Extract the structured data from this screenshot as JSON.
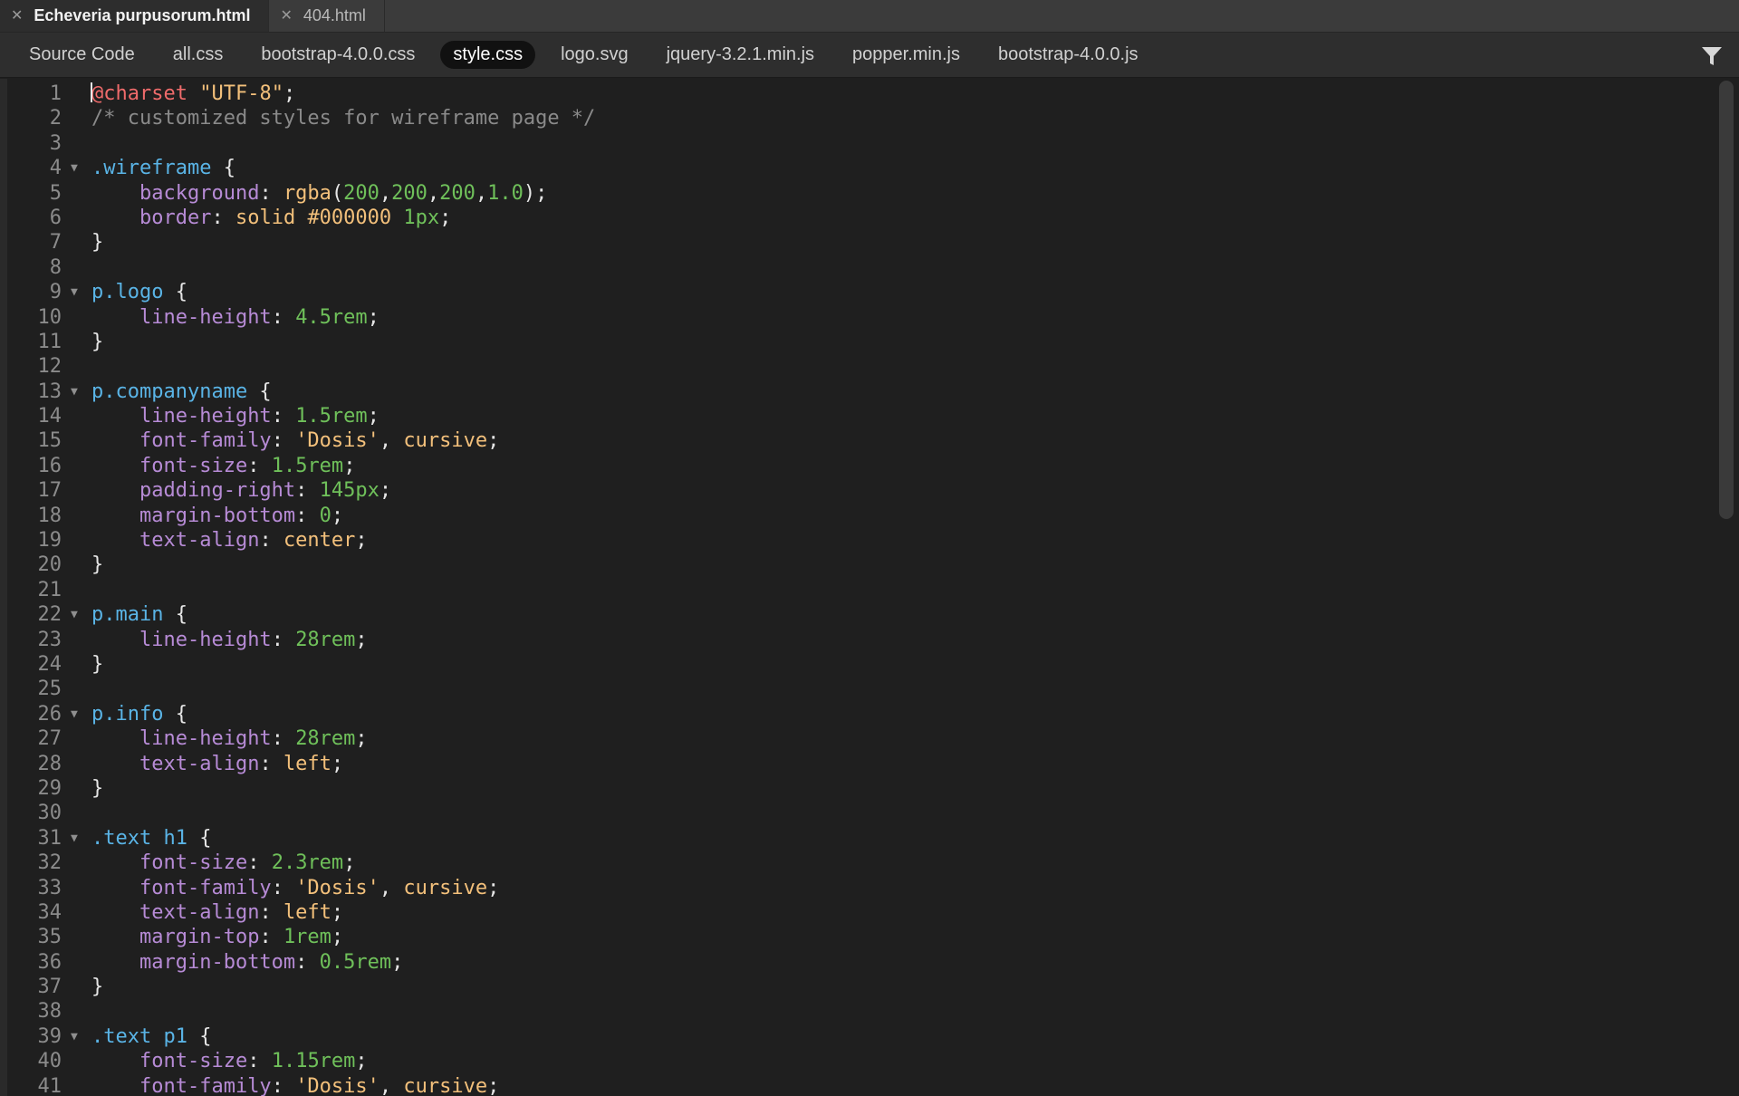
{
  "file_tabs": [
    {
      "label": "Echeveria purpusorum.html",
      "active": true
    },
    {
      "label": "404.html",
      "active": false
    }
  ],
  "related_files": [
    {
      "label": "Source Code",
      "active": false
    },
    {
      "label": "all.css",
      "active": false
    },
    {
      "label": "bootstrap-4.0.0.css",
      "active": false
    },
    {
      "label": "style.css",
      "active": true
    },
    {
      "label": "logo.svg",
      "active": false
    },
    {
      "label": "jquery-3.2.1.min.js",
      "active": false
    },
    {
      "label": "popper.min.js",
      "active": false
    },
    {
      "label": "bootstrap-4.0.0.js",
      "active": false
    }
  ],
  "icons": {
    "close_glyph": "✕",
    "fold_glyph": "▼",
    "filter": "filter-icon"
  },
  "colors": {
    "keyword_at": "#ef6b6b",
    "string": "#f3c07b",
    "comment": "#8a8a8a",
    "selector": "#5ab4e6",
    "property": "#b78bd6",
    "number": "#6fc05a",
    "value": "#f3c07b"
  },
  "editor": {
    "lines": [
      {
        "n": "1",
        "fold": false,
        "tokens": [
          [
            "at",
            "@charset"
          ],
          [
            "pun",
            " "
          ],
          [
            "str",
            "\"UTF-8\""
          ],
          [
            "pun",
            ";"
          ]
        ]
      },
      {
        "n": "2",
        "fold": false,
        "tokens": [
          [
            "com",
            "/* customized styles for wireframe page */"
          ]
        ]
      },
      {
        "n": "3",
        "fold": false,
        "tokens": []
      },
      {
        "n": "4",
        "fold": true,
        "tokens": [
          [
            "sel",
            ".wireframe"
          ],
          [
            "pun",
            " {"
          ]
        ]
      },
      {
        "n": "5",
        "fold": false,
        "tokens": [
          [
            "pun",
            "    "
          ],
          [
            "prop",
            "background"
          ],
          [
            "pun",
            ": "
          ],
          [
            "val",
            "rgba"
          ],
          [
            "pun",
            "("
          ],
          [
            "num",
            "200"
          ],
          [
            "pun",
            ","
          ],
          [
            "num",
            "200"
          ],
          [
            "pun",
            ","
          ],
          [
            "num",
            "200"
          ],
          [
            "pun",
            ","
          ],
          [
            "num",
            "1.0"
          ],
          [
            "pun",
            ");"
          ]
        ]
      },
      {
        "n": "6",
        "fold": false,
        "tokens": [
          [
            "pun",
            "    "
          ],
          [
            "prop",
            "border"
          ],
          [
            "pun",
            ": "
          ],
          [
            "val",
            "solid #000000 "
          ],
          [
            "num",
            "1px"
          ],
          [
            "pun",
            ";"
          ]
        ]
      },
      {
        "n": "7",
        "fold": false,
        "tokens": [
          [
            "pun",
            "}"
          ]
        ]
      },
      {
        "n": "8",
        "fold": false,
        "tokens": []
      },
      {
        "n": "9",
        "fold": true,
        "tokens": [
          [
            "sel",
            "p.logo"
          ],
          [
            "pun",
            " {"
          ]
        ]
      },
      {
        "n": "10",
        "fold": false,
        "tokens": [
          [
            "pun",
            "    "
          ],
          [
            "prop",
            "line-height"
          ],
          [
            "pun",
            ": "
          ],
          [
            "num",
            "4.5rem"
          ],
          [
            "pun",
            ";"
          ]
        ]
      },
      {
        "n": "11",
        "fold": false,
        "tokens": [
          [
            "pun",
            "}"
          ]
        ]
      },
      {
        "n": "12",
        "fold": false,
        "tokens": []
      },
      {
        "n": "13",
        "fold": true,
        "tokens": [
          [
            "sel",
            "p.companyname"
          ],
          [
            "pun",
            " {"
          ]
        ]
      },
      {
        "n": "14",
        "fold": false,
        "tokens": [
          [
            "pun",
            "    "
          ],
          [
            "prop",
            "line-height"
          ],
          [
            "pun",
            ": "
          ],
          [
            "num",
            "1.5rem"
          ],
          [
            "pun",
            ";"
          ]
        ]
      },
      {
        "n": "15",
        "fold": false,
        "tokens": [
          [
            "pun",
            "    "
          ],
          [
            "prop",
            "font-family"
          ],
          [
            "pun",
            ": "
          ],
          [
            "str",
            "'Dosis'"
          ],
          [
            "pun",
            ", "
          ],
          [
            "val",
            "cursive"
          ],
          [
            "pun",
            ";"
          ]
        ]
      },
      {
        "n": "16",
        "fold": false,
        "tokens": [
          [
            "pun",
            "    "
          ],
          [
            "prop",
            "font-size"
          ],
          [
            "pun",
            ": "
          ],
          [
            "num",
            "1.5rem"
          ],
          [
            "pun",
            ";"
          ]
        ]
      },
      {
        "n": "17",
        "fold": false,
        "tokens": [
          [
            "pun",
            "    "
          ],
          [
            "prop",
            "padding-right"
          ],
          [
            "pun",
            ": "
          ],
          [
            "num",
            "145px"
          ],
          [
            "pun",
            ";"
          ]
        ]
      },
      {
        "n": "18",
        "fold": false,
        "tokens": [
          [
            "pun",
            "    "
          ],
          [
            "prop",
            "margin-bottom"
          ],
          [
            "pun",
            ": "
          ],
          [
            "num",
            "0"
          ],
          [
            "pun",
            ";"
          ]
        ]
      },
      {
        "n": "19",
        "fold": false,
        "tokens": [
          [
            "pun",
            "    "
          ],
          [
            "prop",
            "text-align"
          ],
          [
            "pun",
            ": "
          ],
          [
            "val",
            "center"
          ],
          [
            "pun",
            ";"
          ]
        ]
      },
      {
        "n": "20",
        "fold": false,
        "tokens": [
          [
            "pun",
            "}"
          ]
        ]
      },
      {
        "n": "21",
        "fold": false,
        "tokens": []
      },
      {
        "n": "22",
        "fold": true,
        "tokens": [
          [
            "sel",
            "p.main"
          ],
          [
            "pun",
            " {"
          ]
        ]
      },
      {
        "n": "23",
        "fold": false,
        "tokens": [
          [
            "pun",
            "    "
          ],
          [
            "prop",
            "line-height"
          ],
          [
            "pun",
            ": "
          ],
          [
            "num",
            "28rem"
          ],
          [
            "pun",
            ";"
          ]
        ]
      },
      {
        "n": "24",
        "fold": false,
        "tokens": [
          [
            "pun",
            "}"
          ]
        ]
      },
      {
        "n": "25",
        "fold": false,
        "tokens": []
      },
      {
        "n": "26",
        "fold": true,
        "tokens": [
          [
            "sel",
            "p.info"
          ],
          [
            "pun",
            " {"
          ]
        ]
      },
      {
        "n": "27",
        "fold": false,
        "tokens": [
          [
            "pun",
            "    "
          ],
          [
            "prop",
            "line-height"
          ],
          [
            "pun",
            ": "
          ],
          [
            "num",
            "28rem"
          ],
          [
            "pun",
            ";"
          ]
        ]
      },
      {
        "n": "28",
        "fold": false,
        "tokens": [
          [
            "pun",
            "    "
          ],
          [
            "prop",
            "text-align"
          ],
          [
            "pun",
            ": "
          ],
          [
            "val",
            "left"
          ],
          [
            "pun",
            ";"
          ]
        ]
      },
      {
        "n": "29",
        "fold": false,
        "tokens": [
          [
            "pun",
            "}"
          ]
        ]
      },
      {
        "n": "30",
        "fold": false,
        "tokens": []
      },
      {
        "n": "31",
        "fold": true,
        "tokens": [
          [
            "sel",
            ".text h1"
          ],
          [
            "pun",
            " {"
          ]
        ]
      },
      {
        "n": "32",
        "fold": false,
        "tokens": [
          [
            "pun",
            "    "
          ],
          [
            "prop",
            "font-size"
          ],
          [
            "pun",
            ": "
          ],
          [
            "num",
            "2.3rem"
          ],
          [
            "pun",
            ";"
          ]
        ]
      },
      {
        "n": "33",
        "fold": false,
        "tokens": [
          [
            "pun",
            "    "
          ],
          [
            "prop",
            "font-family"
          ],
          [
            "pun",
            ": "
          ],
          [
            "str",
            "'Dosis'"
          ],
          [
            "pun",
            ", "
          ],
          [
            "val",
            "cursive"
          ],
          [
            "pun",
            ";"
          ]
        ]
      },
      {
        "n": "34",
        "fold": false,
        "tokens": [
          [
            "pun",
            "    "
          ],
          [
            "prop",
            "text-align"
          ],
          [
            "pun",
            ": "
          ],
          [
            "val",
            "left"
          ],
          [
            "pun",
            ";"
          ]
        ]
      },
      {
        "n": "35",
        "fold": false,
        "tokens": [
          [
            "pun",
            "    "
          ],
          [
            "prop",
            "margin-top"
          ],
          [
            "pun",
            ": "
          ],
          [
            "num",
            "1rem"
          ],
          [
            "pun",
            ";"
          ]
        ]
      },
      {
        "n": "36",
        "fold": false,
        "tokens": [
          [
            "pun",
            "    "
          ],
          [
            "prop",
            "margin-bottom"
          ],
          [
            "pun",
            ": "
          ],
          [
            "num",
            "0.5rem"
          ],
          [
            "pun",
            ";"
          ]
        ]
      },
      {
        "n": "37",
        "fold": false,
        "tokens": [
          [
            "pun",
            "}"
          ]
        ]
      },
      {
        "n": "38",
        "fold": false,
        "tokens": []
      },
      {
        "n": "39",
        "fold": true,
        "tokens": [
          [
            "sel",
            ".text p1"
          ],
          [
            "pun",
            " {"
          ]
        ]
      },
      {
        "n": "40",
        "fold": false,
        "tokens": [
          [
            "pun",
            "    "
          ],
          [
            "prop",
            "font-size"
          ],
          [
            "pun",
            ": "
          ],
          [
            "num",
            "1.15rem"
          ],
          [
            "pun",
            ";"
          ]
        ]
      },
      {
        "n": "41",
        "fold": false,
        "tokens": [
          [
            "pun",
            "    "
          ],
          [
            "prop",
            "font-family"
          ],
          [
            "pun",
            ": "
          ],
          [
            "str",
            "'Dosis'"
          ],
          [
            "pun",
            ", "
          ],
          [
            "val",
            "cursive"
          ],
          [
            "pun",
            ";"
          ]
        ]
      }
    ]
  }
}
